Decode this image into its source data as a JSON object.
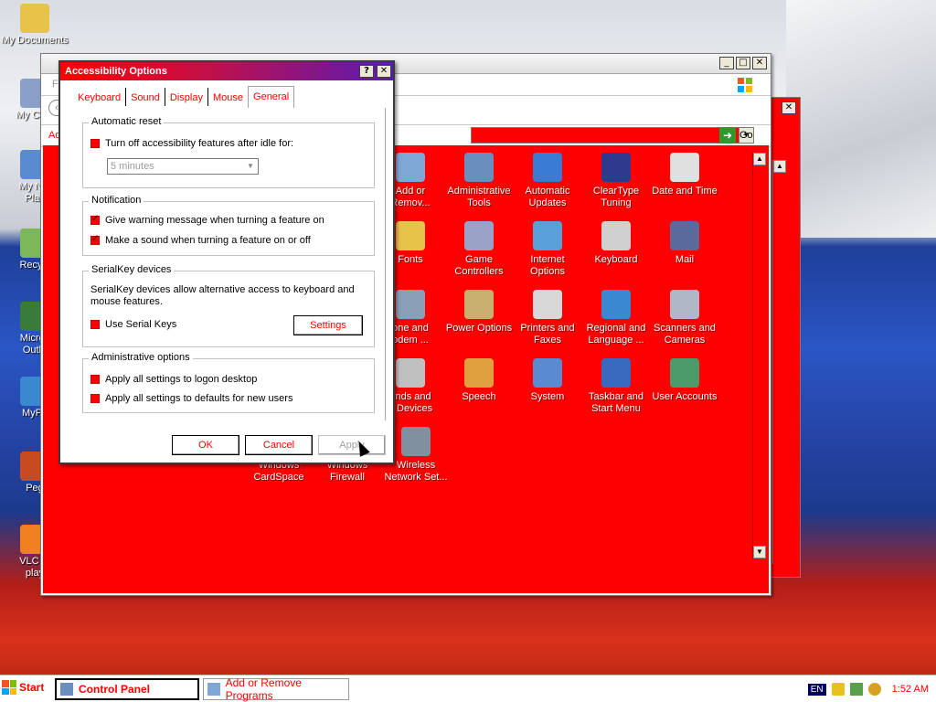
{
  "desktop": {
    "icons": [
      {
        "label": "My Documents",
        "name": "my-documents"
      },
      {
        "label": "My Com",
        "name": "my-computer"
      },
      {
        "label": "My Net\nPlac",
        "name": "my-network-places"
      },
      {
        "label": "Recycl",
        "name": "recycle-bin"
      },
      {
        "label": "Micros\nOutlo",
        "name": "microsoft-outlook"
      },
      {
        "label": "MyPa",
        "name": "mypaint"
      },
      {
        "label": "Peg",
        "name": "pegasus"
      },
      {
        "label": "VLC m\nplay",
        "name": "vlc-media-player"
      }
    ]
  },
  "control_panel": {
    "menu_first_letter": "Fi",
    "address_label": "Ad",
    "go_label": "Go",
    "items": [
      {
        "label": "Add or\nRemov...",
        "color": "#7fa7d6"
      },
      {
        "label": "Administrative\nTools",
        "color": "#6a8fbf"
      },
      {
        "label": "Automatic\nUpdates",
        "color": "#3a7bd5"
      },
      {
        "label": "ClearType\nTuning",
        "color": "#2f3a8f"
      },
      {
        "label": "Date and Time",
        "color": "#e0e0e0"
      },
      {
        "label": "Fonts",
        "color": "#e8c34a"
      },
      {
        "label": "Game\nControllers",
        "color": "#9aa2c8"
      },
      {
        "label": "Internet\nOptions",
        "color": "#5aa0d8"
      },
      {
        "label": "Keyboard",
        "color": "#d0d0d0"
      },
      {
        "label": "Mail",
        "color": "#5a6a9a"
      },
      {
        "label": "one and\nodem ...",
        "color": "#8aa0b8"
      },
      {
        "label": "Power Options",
        "color": "#c8b070"
      },
      {
        "label": "Printers and\nFaxes",
        "color": "#d8d8d8"
      },
      {
        "label": "Regional and\nLanguage ...",
        "color": "#3a88d0"
      },
      {
        "label": "Scanners and\nCameras",
        "color": "#b0b8c8"
      },
      {
        "label": "unds and\no Devices",
        "color": "#c0c0c0"
      },
      {
        "label": "Speech",
        "color": "#e0a040"
      },
      {
        "label": "System",
        "color": "#5a8ad0"
      },
      {
        "label": "Taskbar and\nStart Menu",
        "color": "#3a6ac0"
      },
      {
        "label": "User Accounts",
        "color": "#4a9a6a"
      },
      {
        "label": "Windows\nCardSpace",
        "color": "#ff0000"
      },
      {
        "label": "Windows\nFirewall",
        "color": "#ff0000"
      },
      {
        "label": "Wireless\nNetwork Set...",
        "color": "#8090a0"
      }
    ]
  },
  "dialog": {
    "title": "Accessibility Options",
    "help_glyph": "?",
    "close_glyph": "✕",
    "tabs": [
      "Keyboard",
      "Sound",
      "Display",
      "Mouse",
      "General"
    ],
    "active_tab": "General",
    "automatic_reset": {
      "title": "Automatic reset",
      "checkbox_label": "Turn off accessibility features after idle for:",
      "checked": false,
      "combo_value": "5 minutes"
    },
    "notification": {
      "title": "Notification",
      "warning_label": "Give warning message when turning a feature on",
      "warning_checked": true,
      "sound_label": "Make a sound when turning a feature on or off",
      "sound_checked": true
    },
    "serialkey": {
      "title": "SerialKey devices",
      "description": "SerialKey devices allow alternative access to keyboard and mouse features.",
      "checkbox_label": "Use Serial Keys",
      "checked": false,
      "settings_button": "Settings"
    },
    "admin": {
      "title": "Administrative options",
      "logon_label": "Apply all settings to logon desktop",
      "defaults_label": "Apply all settings to defaults for new users"
    },
    "buttons": {
      "ok": "OK",
      "cancel": "Cancel",
      "apply": "Apply"
    }
  },
  "taskbar": {
    "start_label": "Start",
    "tasks": [
      {
        "label": "Control Panel",
        "active": true
      },
      {
        "label": "Add or Remove Programs",
        "active": false
      }
    ],
    "language": "EN",
    "clock": "1:52 AM"
  },
  "colors": {
    "accent": "#ff0000",
    "title_gradient_end": "#5a1ab4"
  }
}
